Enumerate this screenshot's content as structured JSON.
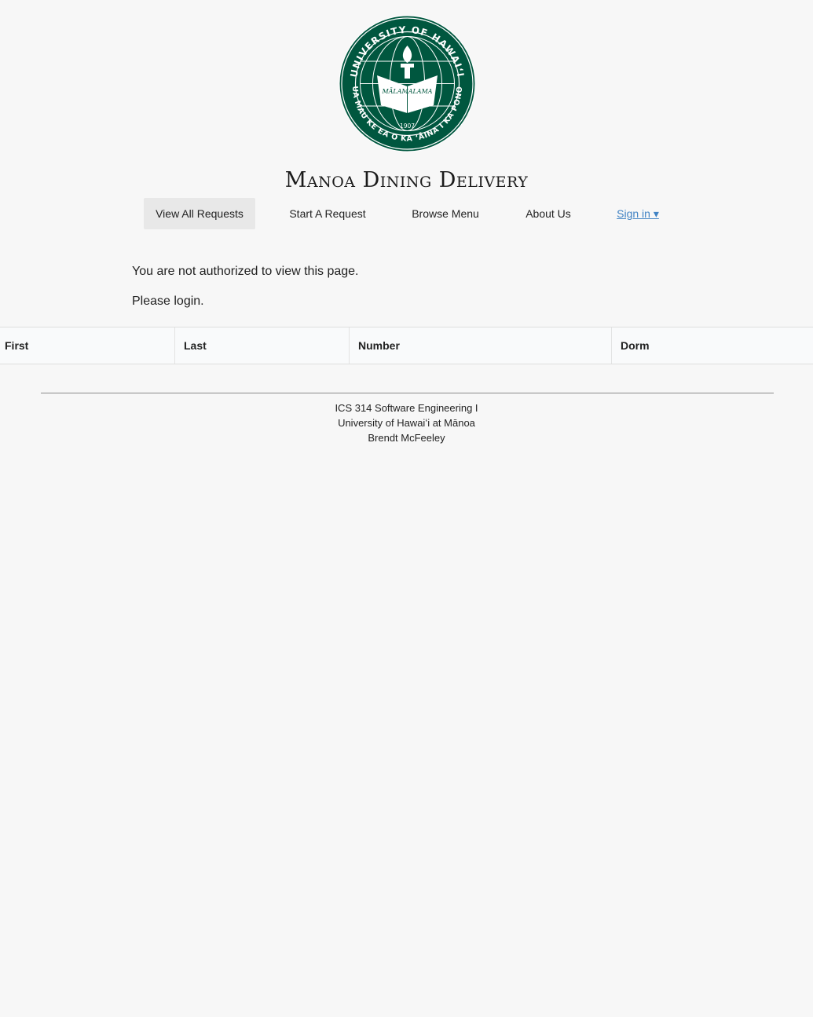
{
  "header": {
    "seal": {
      "outer_text_top": "UNIVERSITY OF HAWAIʻI",
      "outer_text_bottom": "UA MAU KE EA O KA ʻĀINA I KA PONO",
      "banner_text": "MĀLAMALAMA",
      "year": "1907",
      "color": "#00573f"
    },
    "title": "Manoa Dining Delivery"
  },
  "nav": {
    "items": [
      {
        "label": "View All Requests",
        "active": true
      },
      {
        "label": "Start A Request"
      },
      {
        "label": "Browse Menu"
      },
      {
        "label": "About Us"
      }
    ],
    "signin_label": "Sign in ▾",
    "signin_color": "#4183c4"
  },
  "main": {
    "not_authorized": "You are not authorized to view this page.",
    "please_login": "Please login."
  },
  "table": {
    "columns": [
      "First",
      "Last",
      "Number",
      "Dorm"
    ]
  },
  "footer": {
    "line1": "ICS 314 Software Engineering I",
    "line2": "University of Hawaiʻi at Mānoa",
    "line3": "Brendt McFeeley"
  }
}
